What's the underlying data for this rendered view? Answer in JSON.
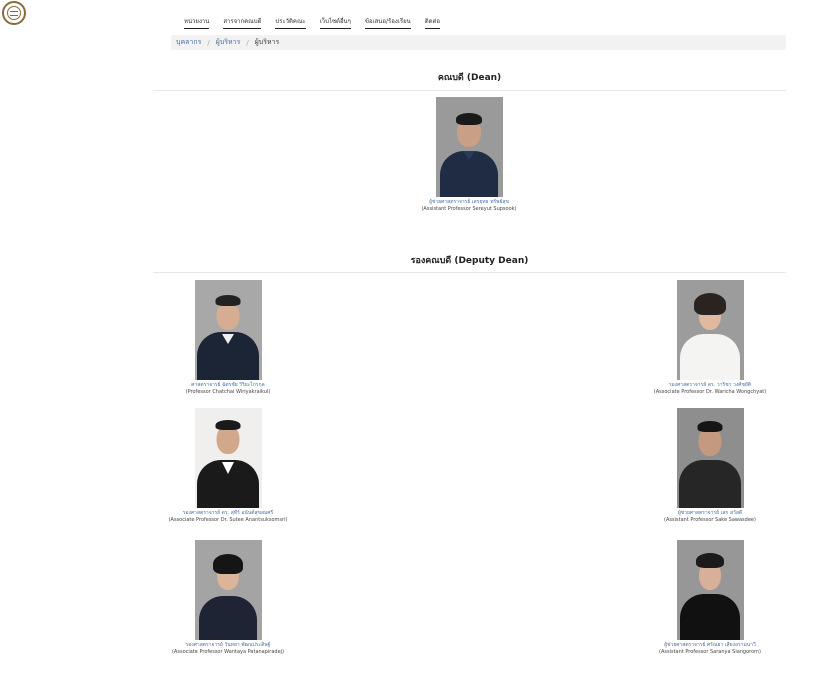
{
  "site": {
    "logo_icon": "university-seal-icon"
  },
  "nav": [
    {
      "label": "หน่วยงาน"
    },
    {
      "label": "สารจากคณบดี"
    },
    {
      "label": "ประวัติคณะ"
    },
    {
      "label": "เว็บไซต์อื่นๆ"
    },
    {
      "label": "ข้อเสนอ/ร้องเรียน"
    },
    {
      "label": "ติดต่อ"
    }
  ],
  "breadcrumb": {
    "items": [
      "บุคลากร",
      "ผู้บริหาร"
    ],
    "separator": "/",
    "current": "ผู้บริหาร"
  },
  "dean_section": {
    "title": "คณบดี (Dean)",
    "person": {
      "name_th": "ผู้ช่วยศาสตราจารย์ เสรยุทธ ทรัพย์สุข",
      "name_en": "(Assistant Professor Sereyut Supsook)"
    }
  },
  "deputy_section": {
    "title": "รองคณบดี (Deputy Dean)",
    "people": [
      {
        "name_th": "ศาสตราจารย์ ฉัตรชัย วิริยะไกรกุล",
        "name_en": "(Professor Chatchai Wiriyakraikul)"
      },
      {
        "name_th": "รองศาสตราจารย์ ดร. วาริชา วงศ์ชยัติ",
        "name_en": "(Associate Professor Dr. Waricha Wongchyat)"
      },
      {
        "name_th": "รองศาสตราจารย์ ดร. สุทีร์ อนันต์สุขสมศรี",
        "name_en": "(Associate Professor Dr. Sutee Anantsuksomsri)"
      },
      {
        "name_th": "ผู้ช่วยศาสตราจารย์ เสก สวัสดี",
        "name_en": "(Assistant Professor Sake Sawasdee)"
      },
      {
        "name_th": "รองศาสตราจารย์ วันทยา พัฒนประดิษฐ์",
        "name_en": "(Associate Professor Wantaya Patanapiradej)"
      },
      {
        "name_th": "ผู้ช่วยศาสตราจารย์ ศรัณยา เสียงอรามนาวี",
        "name_en": "(Assistant Professor Saranya Siangorom)"
      }
    ]
  }
}
